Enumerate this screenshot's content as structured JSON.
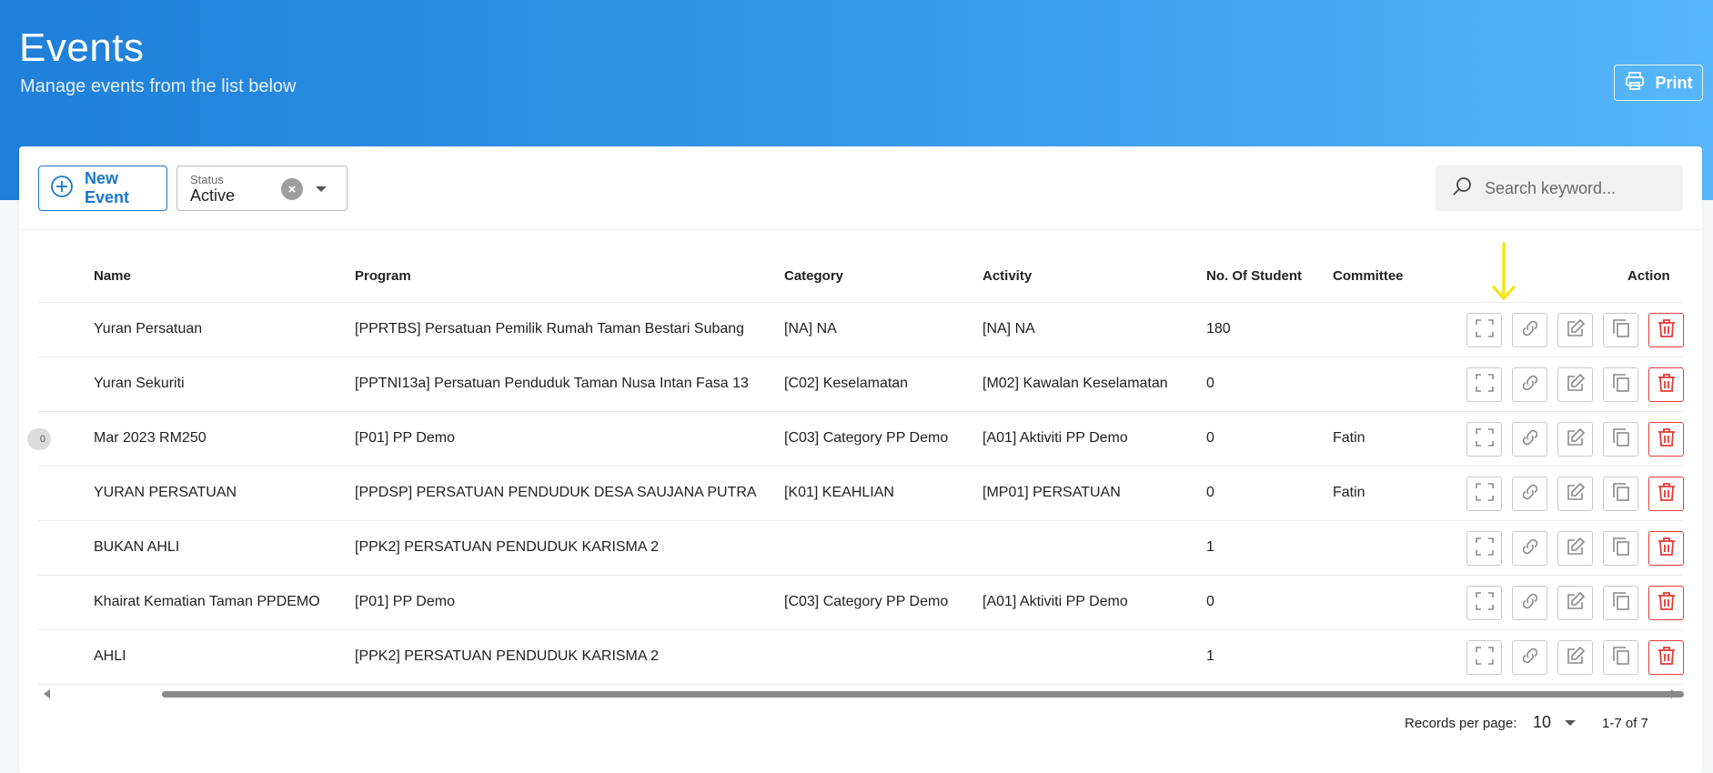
{
  "header": {
    "title": "Events",
    "subtitle": "Manage events from the list below",
    "print_label": "Print"
  },
  "toolbar": {
    "new_event_label": "New Event",
    "status": {
      "label": "Status",
      "value": "Active"
    },
    "search_placeholder": "Search keyword..."
  },
  "table": {
    "columns": {
      "name": "Name",
      "program": "Program",
      "category": "Category",
      "activity": "Activity",
      "students": "No. Of Student",
      "committee": "Committee",
      "action": "Action"
    },
    "rows": [
      {
        "handle": "",
        "name": "Yuran Persatuan",
        "program": "[PPRTBS] Persatuan Pemilik Rumah Taman Bestari Subang",
        "category": "[NA] NA",
        "activity": "[NA] NA",
        "students": "180",
        "committee": ""
      },
      {
        "handle": "",
        "name": "Yuran Sekuriti",
        "program": "[PPTNI13a] Persatuan Penduduk Taman Nusa Intan Fasa 13",
        "category": "[C02] Keselamatan",
        "activity": "[M02] Kawalan Keselamatan",
        "students": "0",
        "committee": ""
      },
      {
        "handle": "0",
        "name": "Mar 2023 RM250",
        "program": "[P01] PP Demo",
        "category": "[C03] Category PP Demo",
        "activity": "[A01] Aktiviti PP Demo",
        "students": "0",
        "committee": "Fatin"
      },
      {
        "handle": "",
        "name": "YURAN PERSATUAN",
        "program": "[PPDSP] PERSATUAN PENDUDUK DESA SAUJANA PUTRA",
        "category": "[K01] KEAHLIAN",
        "activity": "[MP01] PERSATUAN",
        "students": "0",
        "committee": "Fatin"
      },
      {
        "handle": "",
        "name": "BUKAN AHLI",
        "program": "[PPK2] PERSATUAN PENDUDUK KARISMA 2",
        "category": "",
        "activity": "",
        "students": "1",
        "committee": ""
      },
      {
        "handle": "",
        "name": "Khairat Kematian Taman PPDEMO",
        "program": "[P01] PP Demo",
        "category": "[C03] Category PP Demo",
        "activity": "[A01] Aktiviti PP Demo",
        "students": "0",
        "committee": ""
      },
      {
        "handle": "",
        "name": "AHLI",
        "program": "[PPK2] PERSATUAN PENDUDUK KARISMA 2",
        "category": "",
        "activity": "",
        "students": "1",
        "committee": ""
      }
    ],
    "row_actions": [
      "fullscreen-icon",
      "link-icon",
      "edit-icon",
      "copy-icon",
      "trash-icon"
    ]
  },
  "pagination": {
    "records_label": "Records per page:",
    "records_value": "10",
    "range": "1-7 of 7"
  },
  "colors": {
    "accent": "#1976d2",
    "danger": "#e53935",
    "annotation": "#f5e41c"
  }
}
